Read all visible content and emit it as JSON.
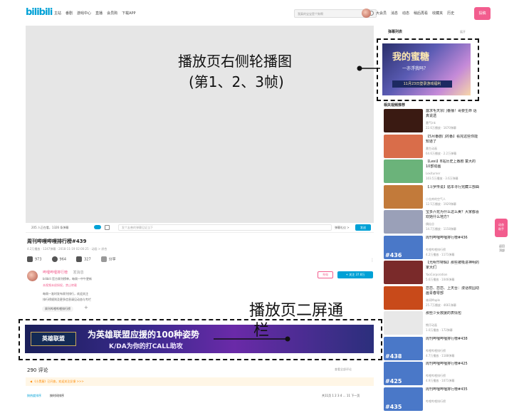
{
  "topbar": {
    "logo": "bilibili",
    "nav": [
      "主站",
      "番剧",
      "游戏中心",
      "直播",
      "会员购",
      "下载APP"
    ],
    "search_placeholder": "我真的宝宝是个狗啊",
    "right_nav": [
      "大会员",
      "消息",
      "动态",
      "稍后再看",
      "收藏夹",
      "历史"
    ],
    "upload": "投稿"
  },
  "danmaku_bar": {
    "watching": "205 人正在看，1326 条弹幕",
    "input_placeholder": "发个友善的弹幕见证当下",
    "etiquette": "弹幕礼仪 >",
    "send": "发送"
  },
  "video": {
    "title": "周刊哔哩哔哩排行榜#439",
    "meta": "4.2万播放 · 1247弹幕 · 2018-11-19 02:00:25 · 动画 > 综合",
    "actions": [
      {
        "icon": "like-icon",
        "count": "973"
      },
      {
        "icon": "coin-icon",
        "count": "964"
      },
      {
        "icon": "star-icon",
        "count": "327"
      },
      {
        "icon": "share-icon",
        "count": "分享"
      }
    ]
  },
  "uploader": {
    "name": "哔哩哔哩排行榜",
    "badge": "发消息",
    "line1": "bilibili 官方周刊榜单，每周一中午更新",
    "line2": "本视频未经授权，禁止转载",
    "line3": "每周一准时发布周刊排行，欢迎关注",
    "line4": "排行榜规则及更多信息请见动态与专栏",
    "charge": "充电",
    "follow": "+ 关注 37.8万",
    "tag": "周刊哔哩哔哩排行榜"
  },
  "ad": {
    "logo": "英雄联盟",
    "main": "为英雄联盟应援的100种姿势",
    "sub": "K/DA为你的打CALL助攻"
  },
  "annotations": {
    "carousel_line1": "播放页右侧轮播图",
    "carousel_line2": "(第1、2、3帧)",
    "banner_line1": "播放页二屏通",
    "banner_line2": "栏"
  },
  "comments": {
    "header": "290 评论",
    "right": "查看全部评论",
    "notice": "《小黑屋》已开放，欢迎关注反馈 >>>",
    "tab1": "按热度排序",
    "tab2": "按时间排序",
    "pager": "共11页  1 2 3 4 … 11  下一页"
  },
  "sidebar": {
    "danmaku_list": "弹幕列表",
    "expand": "展开",
    "carousel_title": "我的蜜糖",
    "carousel_sub": "一亦浮我吗？",
    "carousel_band": "11月23日登录游戏福利",
    "recommend_head": "相关视频推荐",
    "recs": [
      {
        "title": "露求毛天宗门番播！哥要生命 话真说透",
        "author": "番气ink",
        "meta": "22.6万播放 · 1670弹幕",
        "num": "",
        "color": "#3a1a12"
      },
      {
        "title": "【5月番剧门的番】看完这些你能知道了",
        "author": "番生动画",
        "meta": "64.6万播放 · 2.2万弹幕",
        "num": "",
        "color": "#d96d4a"
      },
      {
        "title": "【Lexi】B站历史上番剧 童大的10部动画",
        "author": "Lexiturner",
        "meta": "103.5万播放 · 3.6万弹幕",
        "num": "",
        "color": "#6bb37a"
      },
      {
        "title": "【斗罗传说】骷本寻行完藏三部曲",
        "author": "小仓库的空气人",
        "meta": "12.5万播放 · 1929弹幕",
        "num": "",
        "color": "#c27a3a"
      },
      {
        "title": "宝多六花为什么这么美？大家都喜欢她什么地方？",
        "author": "偶仙谷",
        "meta": "14.7万播放 · 1158弹幕",
        "num": "",
        "color": "#9aa0b8"
      },
      {
        "title": "周刊哔哩哔哩排行榜#436",
        "author": "哔哩哔哩排行榜",
        "meta": "4.2万播放 · 1171弹幕",
        "num": "#436",
        "color": "#4a78c8"
      },
      {
        "title": "【光明节特辑】那些被吸进神明的家大们",
        "author": "YaoCorporation",
        "meta": "5.6万播放 · 1046弹幕",
        "num": "",
        "color": "#7a2a2a"
      },
      {
        "title": "恋恋、恋恋、上天台：漫话校园动画青春零部",
        "author": "林间Maple",
        "meta": "25.7万播放 · 4661弹幕",
        "num": "",
        "color": "#c84a1a"
      },
      {
        "title": "那些少女救援的表情包",
        "author": "熊仔动画",
        "meta": "1.0万播放 · 172弹幕",
        "num": "",
        "color": "#e8e8e8"
      },
      {
        "title": "周刊哔哩哔哩排行榜#438",
        "author": "哔哩哔哩排行榜",
        "meta": "4.7万播放 · 1188弹幕",
        "num": "#438",
        "color": "#4a78c8"
      },
      {
        "title": "周刊哔哩哔哩排行榜#425",
        "author": "哔哩哔哩排行榜",
        "meta": "4.9万播放 · 1071弹幕",
        "num": "#425",
        "color": "#4a78c8"
      },
      {
        "title": "周刊哔哩哔哩排行榜#435",
        "author": "哔哩哔哩排行榜",
        "meta": "",
        "num": "#435",
        "color": "#4a78c8"
      }
    ]
  },
  "floating": {
    "pink": "动态\n助手",
    "feedback": "返回\n顶部"
  }
}
